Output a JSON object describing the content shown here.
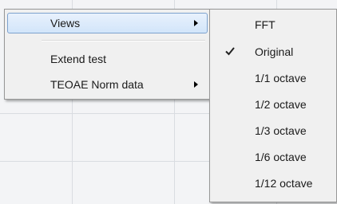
{
  "context_menu": {
    "items": [
      {
        "label": "Views",
        "has_submenu": true,
        "highlighted": true
      },
      {
        "label": "Extend test",
        "has_submenu": false
      },
      {
        "label": "TEOAE Norm data",
        "has_submenu": true
      }
    ]
  },
  "views_submenu": {
    "items": [
      {
        "label": "FFT",
        "checked": false
      },
      {
        "label": "Original",
        "checked": true
      },
      {
        "label": "1/1 octave",
        "checked": false
      },
      {
        "label": "1/2 octave",
        "checked": false
      },
      {
        "label": "1/3 octave",
        "checked": false
      },
      {
        "label": "1/6 octave",
        "checked": false
      },
      {
        "label": "1/12 octave",
        "checked": false
      }
    ]
  },
  "colors": {
    "menu_bg": "#f0f0f0",
    "menu_border": "#979797",
    "highlight_border": "#7da2ce",
    "highlight_fill": "#d2e5fa",
    "grid_line": "#d9dce1"
  },
  "icons": {
    "submenu_arrow": "chevron-right-icon",
    "check": "checkmark-icon"
  }
}
